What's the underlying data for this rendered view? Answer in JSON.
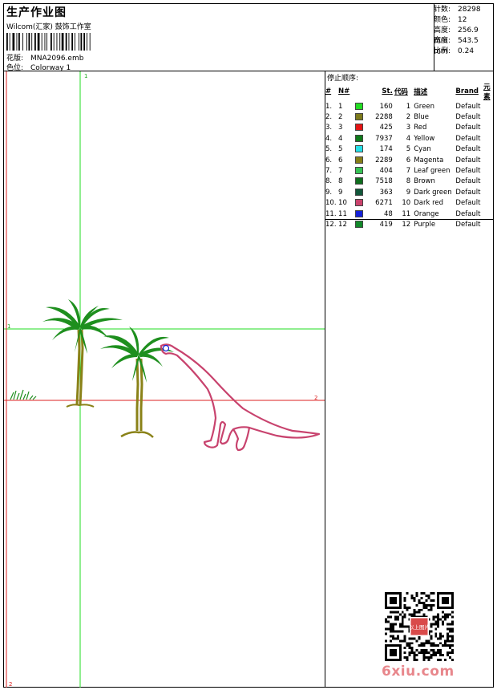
{
  "header": {
    "title": "生产作业图",
    "subtitle": "Wilcom(汇家) 鼓饰工作室",
    "design_label": "花版:",
    "design_value": "MNA2096.emb",
    "colorway_label": "色位:",
    "colorway_value": "Colorway 1"
  },
  "specs": [
    {
      "label": "针数:",
      "value": "28298"
    },
    {
      "label": "颜色:",
      "value": "12"
    },
    {
      "label": "高度:",
      "value": "256.9 mm"
    },
    {
      "label": "宽度:",
      "value": "543.5 mm"
    },
    {
      "label": "比例:",
      "value": "0.24"
    }
  ],
  "stop_sequence_title": "停止顺序:",
  "table_headers": {
    "idx": "#",
    "n": "N#",
    "st": "St.",
    "code": "代码",
    "desc": "描述",
    "brand": "Brand",
    "element": "元素"
  },
  "colors": [
    {
      "idx": "1.",
      "n": "1",
      "color": "#22dd22",
      "st": "160",
      "code": "1",
      "desc": "Green",
      "brand": "Default"
    },
    {
      "idx": "2.",
      "n": "2",
      "color": "#7d7a1c",
      "st": "2288",
      "code": "2",
      "desc": "Blue",
      "brand": "Default"
    },
    {
      "idx": "3.",
      "n": "3",
      "color": "#e31414",
      "st": "425",
      "code": "3",
      "desc": "Red",
      "brand": "Default"
    },
    {
      "idx": "4.",
      "n": "4",
      "color": "#0e7a1a",
      "st": "7937",
      "code": "4",
      "desc": "Yellow",
      "brand": "Default"
    },
    {
      "idx": "5.",
      "n": "5",
      "color": "#25e0e8",
      "st": "174",
      "code": "5",
      "desc": "Cyan",
      "brand": "Default"
    },
    {
      "idx": "6.",
      "n": "6",
      "color": "#857d16",
      "st": "2289",
      "code": "6",
      "desc": "Magenta",
      "brand": "Default"
    },
    {
      "idx": "7.",
      "n": "7",
      "color": "#36c254",
      "st": "404",
      "code": "7",
      "desc": "Leaf green",
      "brand": "Default"
    },
    {
      "idx": "8.",
      "n": "8",
      "color": "#0f6e1e",
      "st": "7518",
      "code": "8",
      "desc": "Brown",
      "brand": "Default"
    },
    {
      "idx": "9.",
      "n": "9",
      "color": "#12573a",
      "st": "363",
      "code": "9",
      "desc": "Dark green",
      "brand": "Default"
    },
    {
      "idx": "10.",
      "n": "10",
      "color": "#c9426c",
      "st": "6271",
      "code": "10",
      "desc": "Dark red",
      "brand": "Default"
    },
    {
      "idx": "11.",
      "n": "11",
      "color": "#1420d8",
      "st": "48",
      "code": "11",
      "desc": "Orange",
      "brand": "Default"
    },
    {
      "idx": "12.",
      "n": "12",
      "color": "#12882a",
      "st": "419",
      "code": "12",
      "desc": "Purple",
      "brand": "Default"
    }
  ],
  "axis_markers": {
    "top": "1",
    "left": "1",
    "right": "2",
    "bottom": "2"
  },
  "watermark": "6xiu.com",
  "seal_text": "以上图片",
  "colors_ui": {
    "guide_green": "#22dd22",
    "guide_red": "#dd2222",
    "dino": "#c8436e",
    "trunk": "#8a8218",
    "leaves": "#1e8f1e"
  }
}
